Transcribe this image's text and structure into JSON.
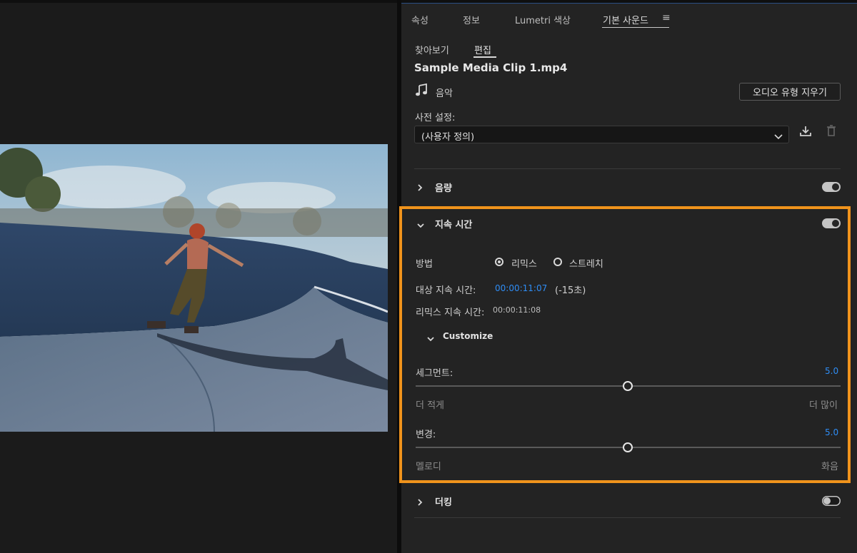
{
  "tabs": [
    {
      "label": "속성"
    },
    {
      "label": "정보"
    },
    {
      "label": "Lumetri 색상"
    },
    {
      "label": "기본 사운드"
    }
  ],
  "subtabs": [
    {
      "label": "찾아보기"
    },
    {
      "label": "편집"
    }
  ],
  "clip": {
    "title": "Sample Media Clip 1.mp4",
    "type_label": "음악",
    "audition_button": "오디오 유형 지우기"
  },
  "preset": {
    "label": "사전 설정:",
    "value": "(사용자 정의)"
  },
  "sections": {
    "loudness": {
      "label": "음량",
      "enabled": true
    },
    "duration": {
      "label": "지속 시간",
      "enabled": true,
      "method_label": "방법",
      "options": [
        {
          "label": "리믹스",
          "selected": true
        },
        {
          "label": "스트레치",
          "selected": false
        }
      ],
      "target_label": "대상 지속 시간:",
      "target_value": "00:00:11:07",
      "target_note": "(-15초)",
      "remix_label": "리믹스 지속 시간:",
      "remix_value": "00:00:11:08",
      "customize_label": "Customize",
      "segments": {
        "label": "세그먼트:",
        "value": "5.0",
        "min_label": "더 적게",
        "max_label": "더 많이",
        "fraction": 0.5
      },
      "variations": {
        "label": "변경:",
        "value": "5.0",
        "min_label": "멜로디",
        "max_label": "화음",
        "fraction": 0.5
      }
    },
    "ducking": {
      "label": "더킹",
      "enabled": false
    }
  },
  "colors": {
    "highlight": "#f0931c",
    "accent_blue": "#2f8df5"
  }
}
